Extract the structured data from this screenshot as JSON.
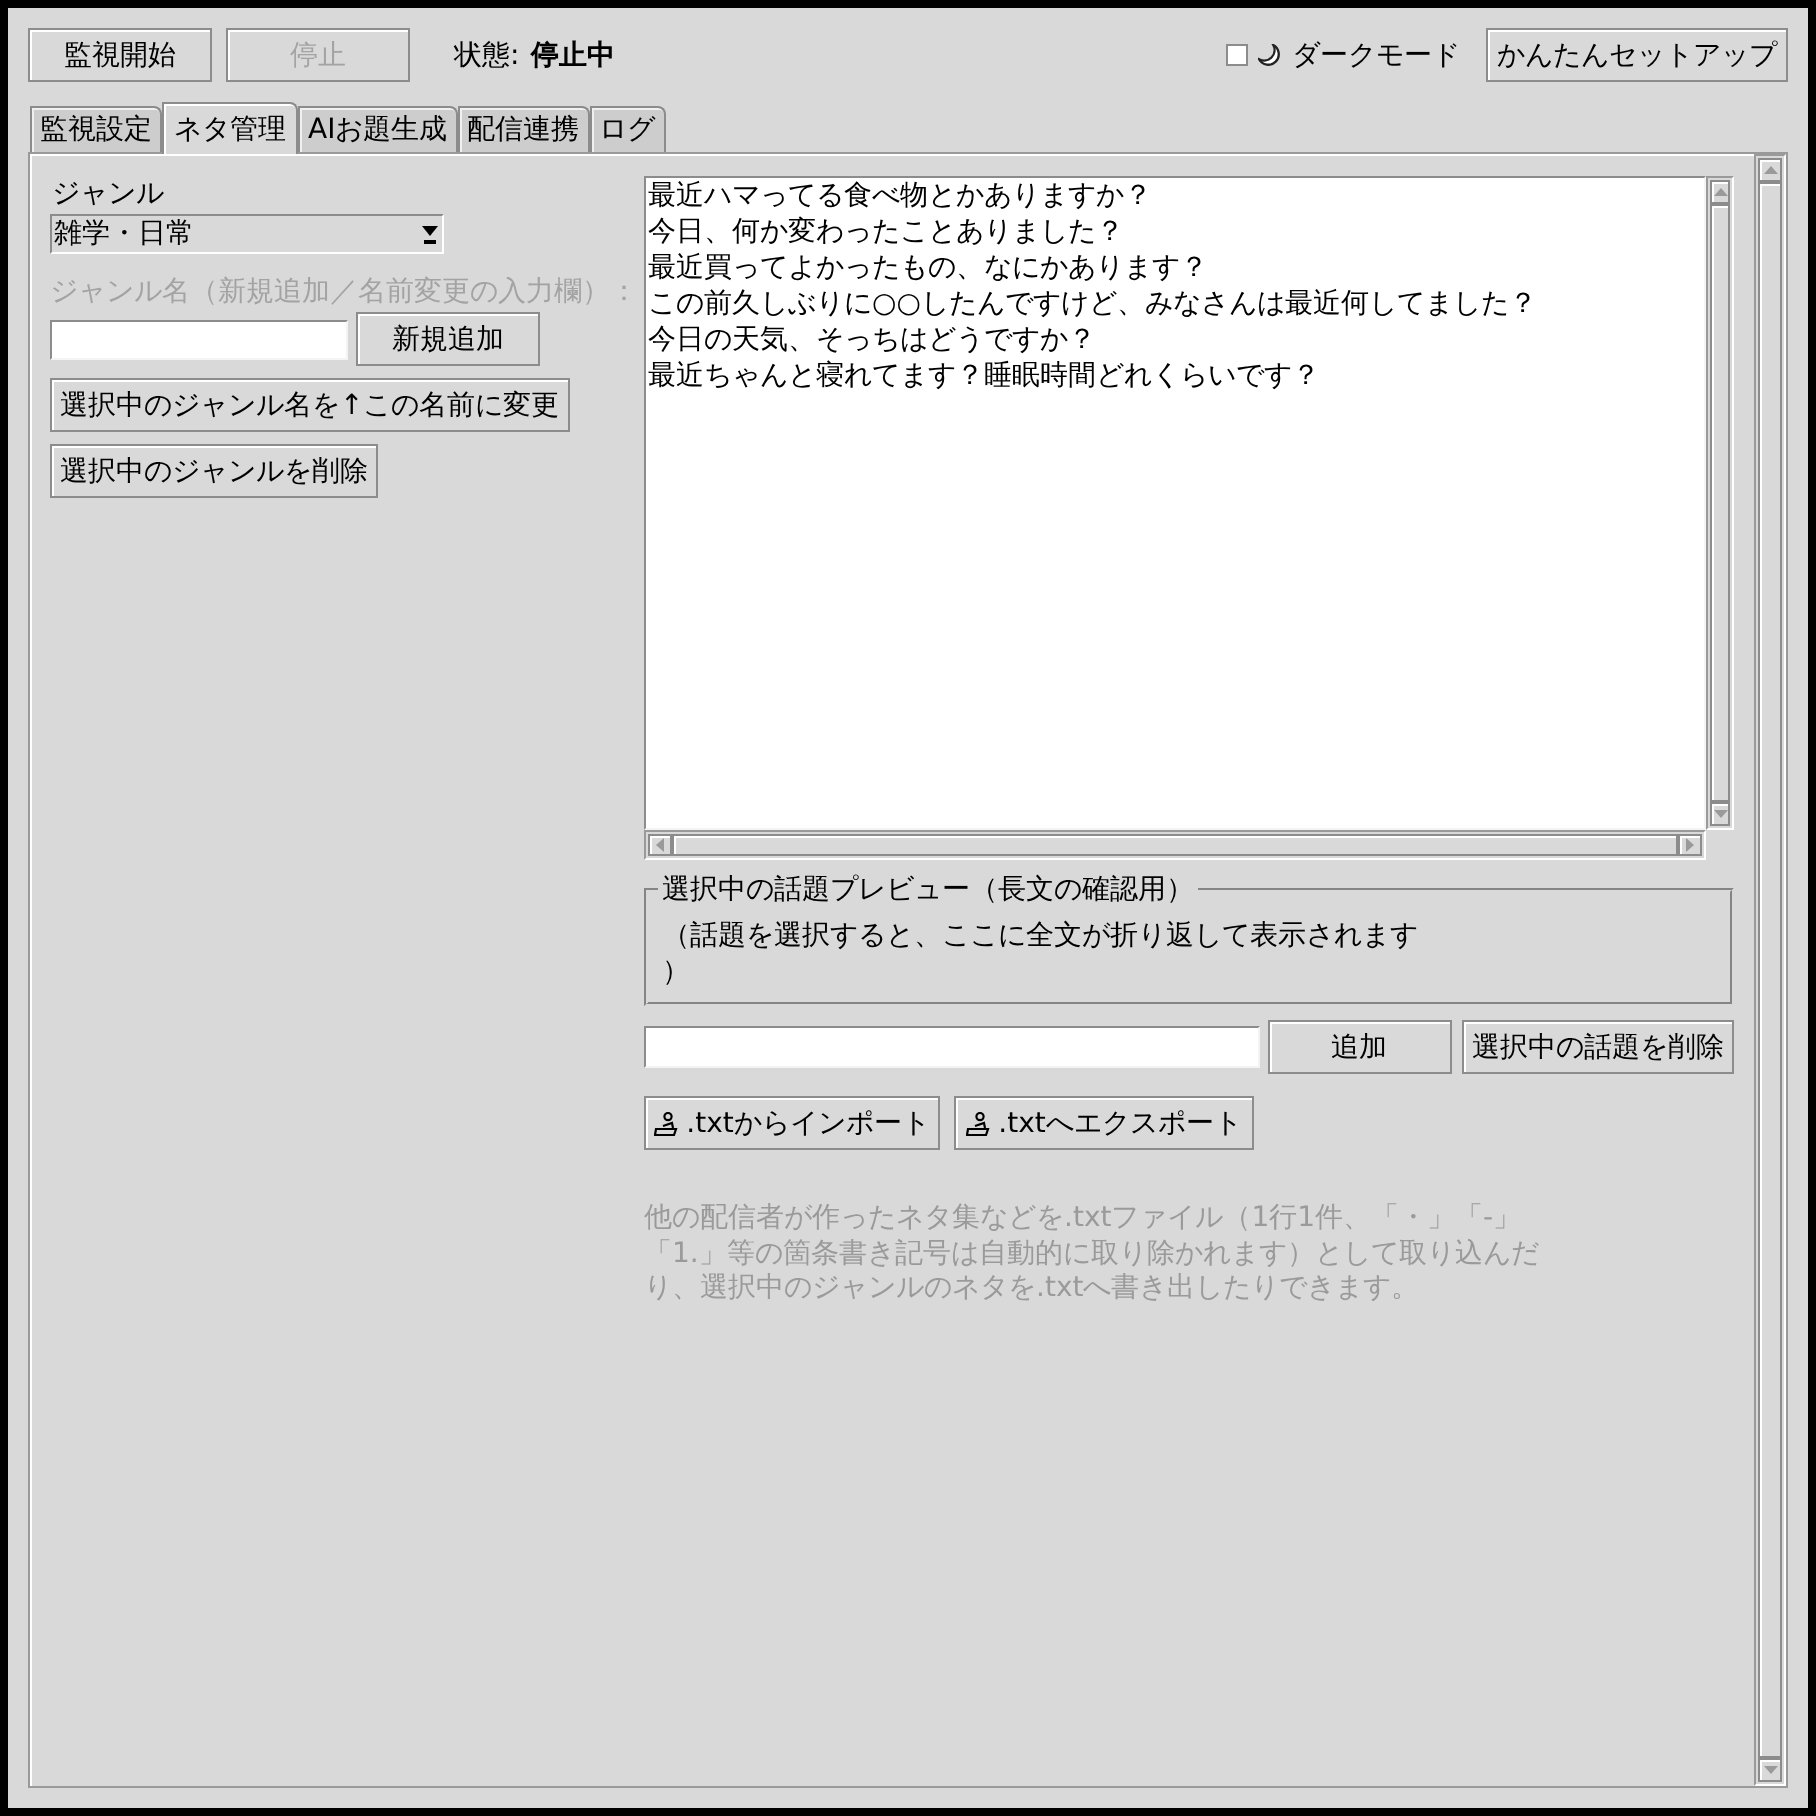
{
  "toolbar": {
    "buttons": [
      {
        "label": "監視開始",
        "disabled": false
      },
      {
        "label": "停止",
        "disabled": true
      }
    ],
    "status": {
      "label": "状態:",
      "value": "停止中"
    },
    "dark_mode": {
      "label": "ダークモード",
      "checked": false
    },
    "setup_button": "かんたんセットアップ"
  },
  "tabs": [
    {
      "label": "監視設定",
      "selected": false
    },
    {
      "label": "ネタ管理",
      "selected": true
    },
    {
      "label": "AIお題生成",
      "selected": false
    },
    {
      "label": "配信連携",
      "selected": false
    },
    {
      "label": "ログ",
      "selected": false
    }
  ],
  "genre": {
    "label": "ジャンル",
    "value": "雑学・日常",
    "name_label": "ジャンル名（新規追加／名前変更の入力欄）：",
    "add_button": "新規追加",
    "rename_button": "選択中のジャンル名を↑この名前に変更",
    "delete_button": "選択中のジャンルを削除"
  },
  "topics": {
    "items": [
      {
        "text": "最近ハマってる食べ物とかありますか？",
        "selected": false
      },
      {
        "text": "今日、何か変わったことありました？",
        "selected": false
      },
      {
        "text": "最近買ってよかったもの、なにかあります？",
        "selected": false
      },
      {
        "text": "この前久しぶりに○○したんですけど、みなさんは最近何してました？",
        "selected": false
      },
      {
        "text": "今日の天気、そっちはどうですか？",
        "selected": false
      },
      {
        "text": "最近ちゃんと寝れてます？睡眠時間どれくらいです？",
        "selected": false
      }
    ],
    "preview": {
      "title": "選択中の話題プレビュー（長文の確認用）",
      "text": "（話題を選択すると、ここに全文が折り返して表示されます）"
    },
    "add_button": "追加",
    "delete_button": "選択中の話題を削除",
    "import_button": ".txtからインポート",
    "export_button": ".txtへエクスポート",
    "help": "他の配信者が作ったネタ集などを.txtファイル（1行1件、「・」「-」「1.」等の箇条書き記号は自動的に取り除かれます）として取り込んだり、選択中のジャンルのネタを.txtへ書き出したりできます。"
  }
}
